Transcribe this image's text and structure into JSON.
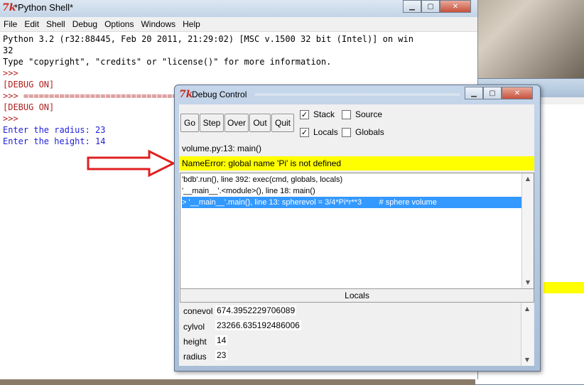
{
  "shell": {
    "title": "*Python Shell*",
    "menu": [
      "File",
      "Edit",
      "Shell",
      "Debug",
      "Options",
      "Windows",
      "Help"
    ],
    "lines": [
      {
        "text": "Python 3.2 (r32:88445, Feb 20 2011, 21:29:02) [MSC v.1500 32 bit (Intel)] on win",
        "style": "normal"
      },
      {
        "text": "32",
        "style": "normal"
      },
      {
        "text": "Type \"copyright\", \"credits\" or \"license()\" for more information.",
        "style": "normal"
      },
      {
        "text": ">>>",
        "style": "red"
      },
      {
        "text": "[DEBUG ON]",
        "style": "red"
      },
      {
        "text": ">>> ================================",
        "style": "red"
      },
      {
        "text": "[DEBUG ON]",
        "style": "red"
      },
      {
        "text": ">>>",
        "style": "red"
      },
      {
        "text": "Enter the radius: 23",
        "style": "blue"
      },
      {
        "text": "Enter the height: 14",
        "style": "blue"
      }
    ]
  },
  "debug": {
    "title": "Debug Control",
    "buttons": [
      "Go",
      "Step",
      "Over",
      "Out",
      "Quit"
    ],
    "checkboxes": [
      {
        "label": "Stack",
        "checked": true
      },
      {
        "label": "Source",
        "checked": false
      },
      {
        "label": "Locals",
        "checked": true
      },
      {
        "label": "Globals",
        "checked": false
      }
    ],
    "status": "volume.py:13: main()",
    "error": "NameError: global name 'Pi' is not defined",
    "stack": [
      {
        "text": "'bdb'.run(), line 392: exec(cmd, globals, locals)",
        "selected": false
      },
      {
        "text": "'__main__'.<module>(), line 18: main()",
        "selected": false
      },
      {
        "text": "> '__main__'.main(), line 13: spherevol = 3/4*Pi*r**3        # sphere volume",
        "selected": true
      }
    ],
    "locals_header": "Locals",
    "locals": [
      {
        "name": "conevol",
        "value": "674.3952229706089"
      },
      {
        "name": "cylvol",
        "value": "23266.635192486006"
      },
      {
        "name": "height",
        "value": "14"
      },
      {
        "name": "radius",
        "value": "23"
      }
    ]
  },
  "colors": {
    "error_bg": "#ffff00",
    "selection": "#3399ff",
    "shell_output": "#1f1fd8",
    "shell_prompt": "#b02020",
    "arrow": "#e02020"
  }
}
